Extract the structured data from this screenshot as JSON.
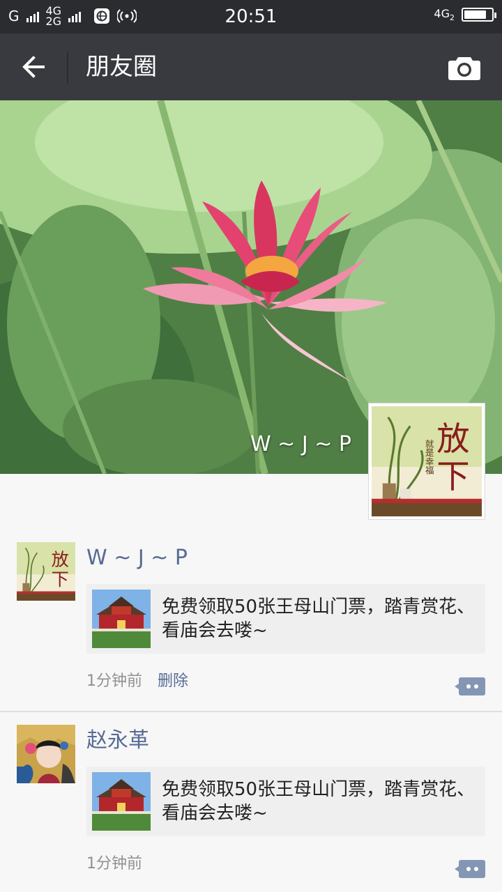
{
  "status_bar": {
    "carrier_1": "G",
    "net_1": "4G",
    "net_2": "2G",
    "right_net": "4G",
    "right_net_sub": "2",
    "time": "20:51",
    "battery_level": 0.82
  },
  "nav": {
    "title": "朋友圈"
  },
  "cover": {
    "owner_name": "W ~ J ~ P"
  },
  "posts": [
    {
      "name": "W ~ J ~ P",
      "card_text": "免费领取50张王母山门票，踏青赏花、看庙会去喽~",
      "time": "1分钟前",
      "delete_label": "删除"
    },
    {
      "name": "赵永革",
      "card_text": "免费领取50张王母山门票，踏青赏花、看庙会去喽~",
      "time": "1分钟前"
    }
  ],
  "colors": {
    "status_bg": "#2b2c30",
    "nav_bg": "#393a3f",
    "link": "#576b95",
    "page_bg": "#f7f7f7",
    "card_bg": "#efefef"
  },
  "icons": {
    "back": "arrow-left-icon",
    "camera": "camera-icon",
    "comment": "comment-icon"
  }
}
